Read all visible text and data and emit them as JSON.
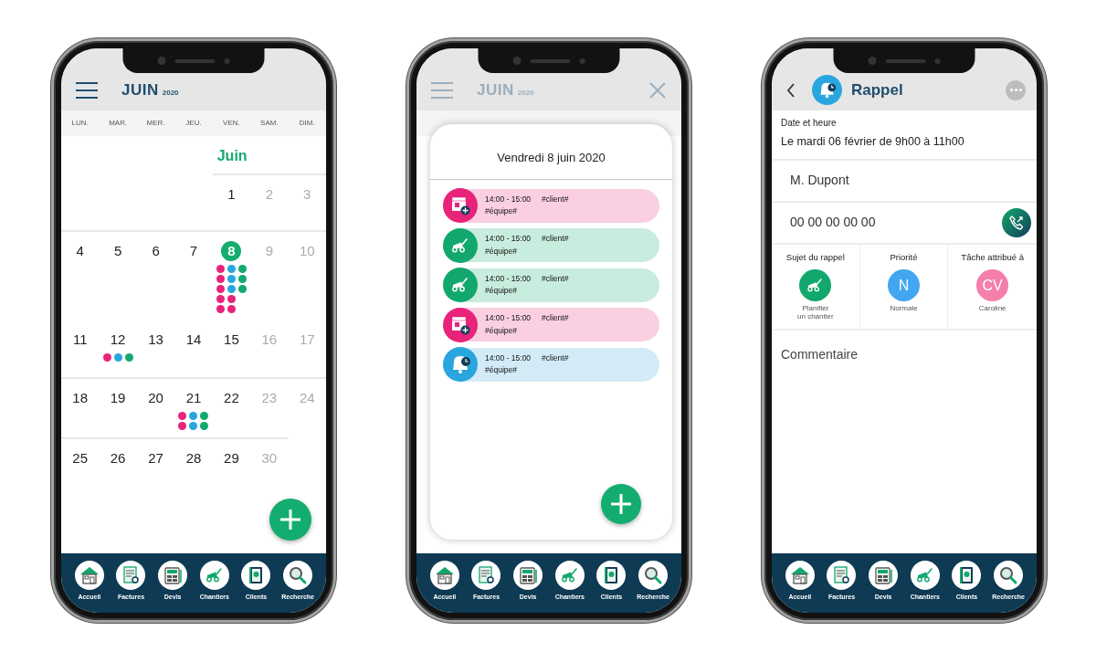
{
  "screens": [
    {
      "kind": "calendar",
      "header": {
        "month": "JUIN",
        "year": "2020"
      },
      "weekdays": [
        "LUN.",
        "MAR.",
        "MER.",
        "JEU.",
        "VEN.",
        "SAM.",
        "DIM."
      ],
      "month_label": "Juin",
      "weeks": [
        {
          "divider": true,
          "days": [
            {
              "kind": "blank"
            },
            {
              "kind": "blank"
            },
            {
              "kind": "blank"
            },
            {
              "kind": "blank"
            },
            {
              "day": "1",
              "muted": false,
              "selected": false
            },
            {
              "day": "2",
              "muted": true,
              "selected": false
            },
            {
              "day": "3",
              "muted": true,
              "selected": false
            }
          ]
        },
        {
          "divider": true,
          "days": [
            {
              "day": "4",
              "muted": false,
              "selected": false
            },
            {
              "day": "5",
              "muted": false,
              "selected": false
            },
            {
              "day": "6",
              "muted": false,
              "selected": false
            },
            {
              "day": "7",
              "muted": false,
              "selected": false
            },
            {
              "day": "8",
              "muted": false,
              "selected": true,
              "dot_rows": [
                [
                  {
                    "color": "#e8237a"
                  },
                  {
                    "color": "#2aa6df"
                  },
                  {
                    "color": "#10a96f"
                  }
                ],
                [
                  {
                    "color": "#e8237a"
                  },
                  {
                    "color": "#2aa6df"
                  },
                  {
                    "color": "#10a96f"
                  }
                ],
                [
                  {
                    "color": "#e8237a"
                  },
                  {
                    "color": "#2aa6df"
                  },
                  {
                    "color": "#10a96f"
                  }
                ],
                [
                  {
                    "color": "#e8237a"
                  },
                  {
                    "color": "#e8237a"
                  }
                ],
                [
                  {
                    "color": "#e8237a"
                  },
                  {
                    "color": "#e8237a"
                  }
                ]
              ]
            },
            {
              "day": "9",
              "muted": true,
              "selected": false
            },
            {
              "day": "10",
              "muted": true,
              "selected": false
            }
          ]
        },
        {
          "divider": false,
          "days": [
            {
              "day": "11",
              "muted": false,
              "selected": false
            },
            {
              "day": "12",
              "muted": false,
              "selected": false,
              "dot_rows": [
                [
                  {
                    "color": "#e8237a"
                  },
                  {
                    "color": "#2aa6df"
                  },
                  {
                    "color": "#10a96f"
                  }
                ]
              ]
            },
            {
              "day": "13",
              "muted": false,
              "selected": false
            },
            {
              "day": "14",
              "muted": false,
              "selected": false
            },
            {
              "day": "15",
              "muted": false,
              "selected": false
            },
            {
              "day": "16",
              "muted": true,
              "selected": false
            },
            {
              "day": "17",
              "muted": true,
              "selected": false
            }
          ]
        },
        {
          "divider": true,
          "days": [
            {
              "day": "18",
              "muted": false,
              "selected": false
            },
            {
              "day": "19",
              "muted": false,
              "selected": false
            },
            {
              "day": "20",
              "muted": false,
              "selected": false
            },
            {
              "day": "21",
              "muted": false,
              "selected": false,
              "dot_rows": [
                [
                  {
                    "color": "#e8237a"
                  },
                  {
                    "color": "#2aa6df"
                  },
                  {
                    "color": "#10a96f"
                  }
                ],
                [
                  {
                    "color": "#e8237a"
                  },
                  {
                    "color": "#2aa6df"
                  },
                  {
                    "color": "#10a96f"
                  }
                ]
              ]
            },
            {
              "day": "22",
              "muted": false,
              "selected": false
            },
            {
              "day": "23",
              "muted": true,
              "selected": false
            },
            {
              "day": "24",
              "muted": true,
              "selected": false
            }
          ]
        },
        {
          "divider": true,
          "days": [
            {
              "day": "25",
              "muted": false,
              "selected": false
            },
            {
              "day": "26",
              "muted": false,
              "selected": false
            },
            {
              "day": "27",
              "muted": false,
              "selected": false
            },
            {
              "day": "28",
              "muted": false,
              "selected": false
            },
            {
              "day": "29",
              "muted": false,
              "selected": false
            },
            {
              "day": "30",
              "muted": true,
              "selected": false
            }
          ]
        }
      ],
      "nav": [
        "Accueil",
        "Factures",
        "Devis",
        "Chantiers",
        "Clients",
        "Recherche"
      ]
    },
    {
      "kind": "day_sheet",
      "header": {
        "month": "JUIN",
        "year": "2020"
      },
      "sheet": {
        "title": "Vendredi 8 juin 2020",
        "events": [
          {
            "kind": "appointment",
            "time": "14:00 - 15:00",
            "client": "#client#",
            "team": "#équipe#"
          },
          {
            "kind": "worksite",
            "time": "14:00 - 15:00",
            "client": "#client#",
            "team": "#équipe#"
          },
          {
            "kind": "worksite",
            "time": "14:00 - 15:00",
            "client": "#client#",
            "team": "#équipe#"
          },
          {
            "kind": "appointment",
            "time": "14:00 - 15:00",
            "client": "#client#",
            "team": "#équipe#"
          },
          {
            "kind": "reminder",
            "time": "14:00 - 15:00",
            "client": "#client#",
            "team": "#équipe#"
          }
        ]
      },
      "nav": [
        "Accueil",
        "Factures",
        "Devis",
        "Chantiers",
        "Clients",
        "Recherche"
      ]
    },
    {
      "kind": "detail",
      "title": "Rappel",
      "date_label": "Date et heure",
      "date_value": "Le mardi 06 février de 9h00 à 11h00",
      "contact": "M. Dupont",
      "phone": "00 00 00 00 00",
      "attributes": [
        {
          "kind": "subject",
          "label": "Sujet du rappel",
          "value": "Planifier\nun chantier"
        },
        {
          "kind": "badge",
          "label": "Priorité",
          "badge": "N",
          "value": "Normale",
          "color": "#42a6f0"
        },
        {
          "kind": "badge",
          "label": "Tâche attribué à",
          "badge": "CV",
          "value": "Caroline",
          "color": "#f57fab"
        }
      ],
      "comment": {
        "placeholder": "Commentaire"
      },
      "nav": [
        "Accueil",
        "Factures",
        "Devis",
        "Chantiers",
        "Clients",
        "Recherche"
      ]
    }
  ]
}
